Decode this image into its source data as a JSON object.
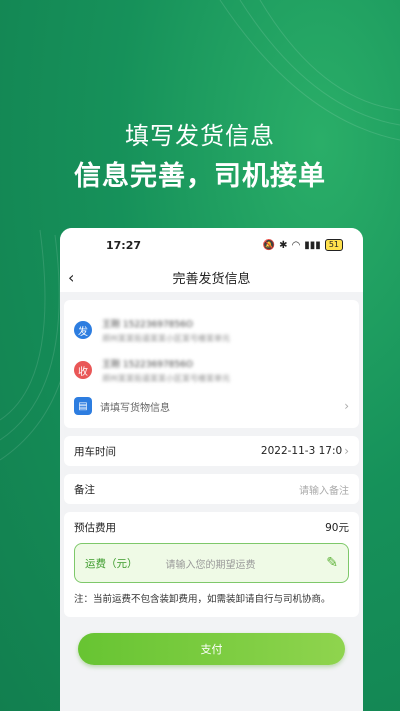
{
  "promo": {
    "title": "填写发货信息",
    "subtitle": "信息完善，司机接单"
  },
  "status_bar": {
    "time": "17:27",
    "battery": "51"
  },
  "nav": {
    "back": "‹",
    "title": "完善发货信息"
  },
  "addresses": {
    "sender": {
      "badge": "发",
      "contact": "王刚 15223697856O",
      "address": "郑州某某街道某某小区某号楼某单元"
    },
    "receiver": {
      "badge": "收",
      "contact": "王刚 15223697856O",
      "address": "郑州某某街道某某小区某号楼某单元"
    },
    "goods_placeholder": "请填写货物信息"
  },
  "vehicle_time": {
    "label": "用车时间",
    "value": "2022-11-3 17:0"
  },
  "remark": {
    "label": "备注",
    "placeholder": "请输入备注"
  },
  "fee": {
    "label": "预估费用",
    "total": "90元",
    "freight_label": "运费（元）",
    "freight_placeholder": "请输入您的期望运费",
    "note": "注：当前运费不包含装卸费用，如需装卸请自行与司机协商。"
  },
  "pay_button": "支付",
  "colors": {
    "brand_green": "#1a9a5a",
    "accent": "#6cc536"
  }
}
